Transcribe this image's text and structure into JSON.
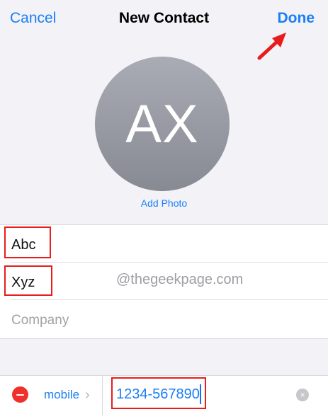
{
  "nav": {
    "cancel_label": "Cancel",
    "title": "New Contact",
    "done_label": "Done"
  },
  "avatar": {
    "initials": "AX",
    "add_photo_label": "Add Photo"
  },
  "fields": {
    "first_name": "Abc",
    "last_name": "Xyz",
    "company_placeholder": "Company"
  },
  "watermark": "@thegeekpage.com",
  "phone": {
    "label": "mobile",
    "chevron": "›",
    "value": "1234-567890",
    "clear_glyph": "×"
  },
  "colors": {
    "accent": "#1a7ef6",
    "highlight_box": "#e81c1c",
    "delete": "#f0302b",
    "background": "#f2f2f7"
  },
  "icons": [
    "red-arrow-icon",
    "remove-field-icon",
    "chevron-right-icon",
    "clear-icon"
  ]
}
